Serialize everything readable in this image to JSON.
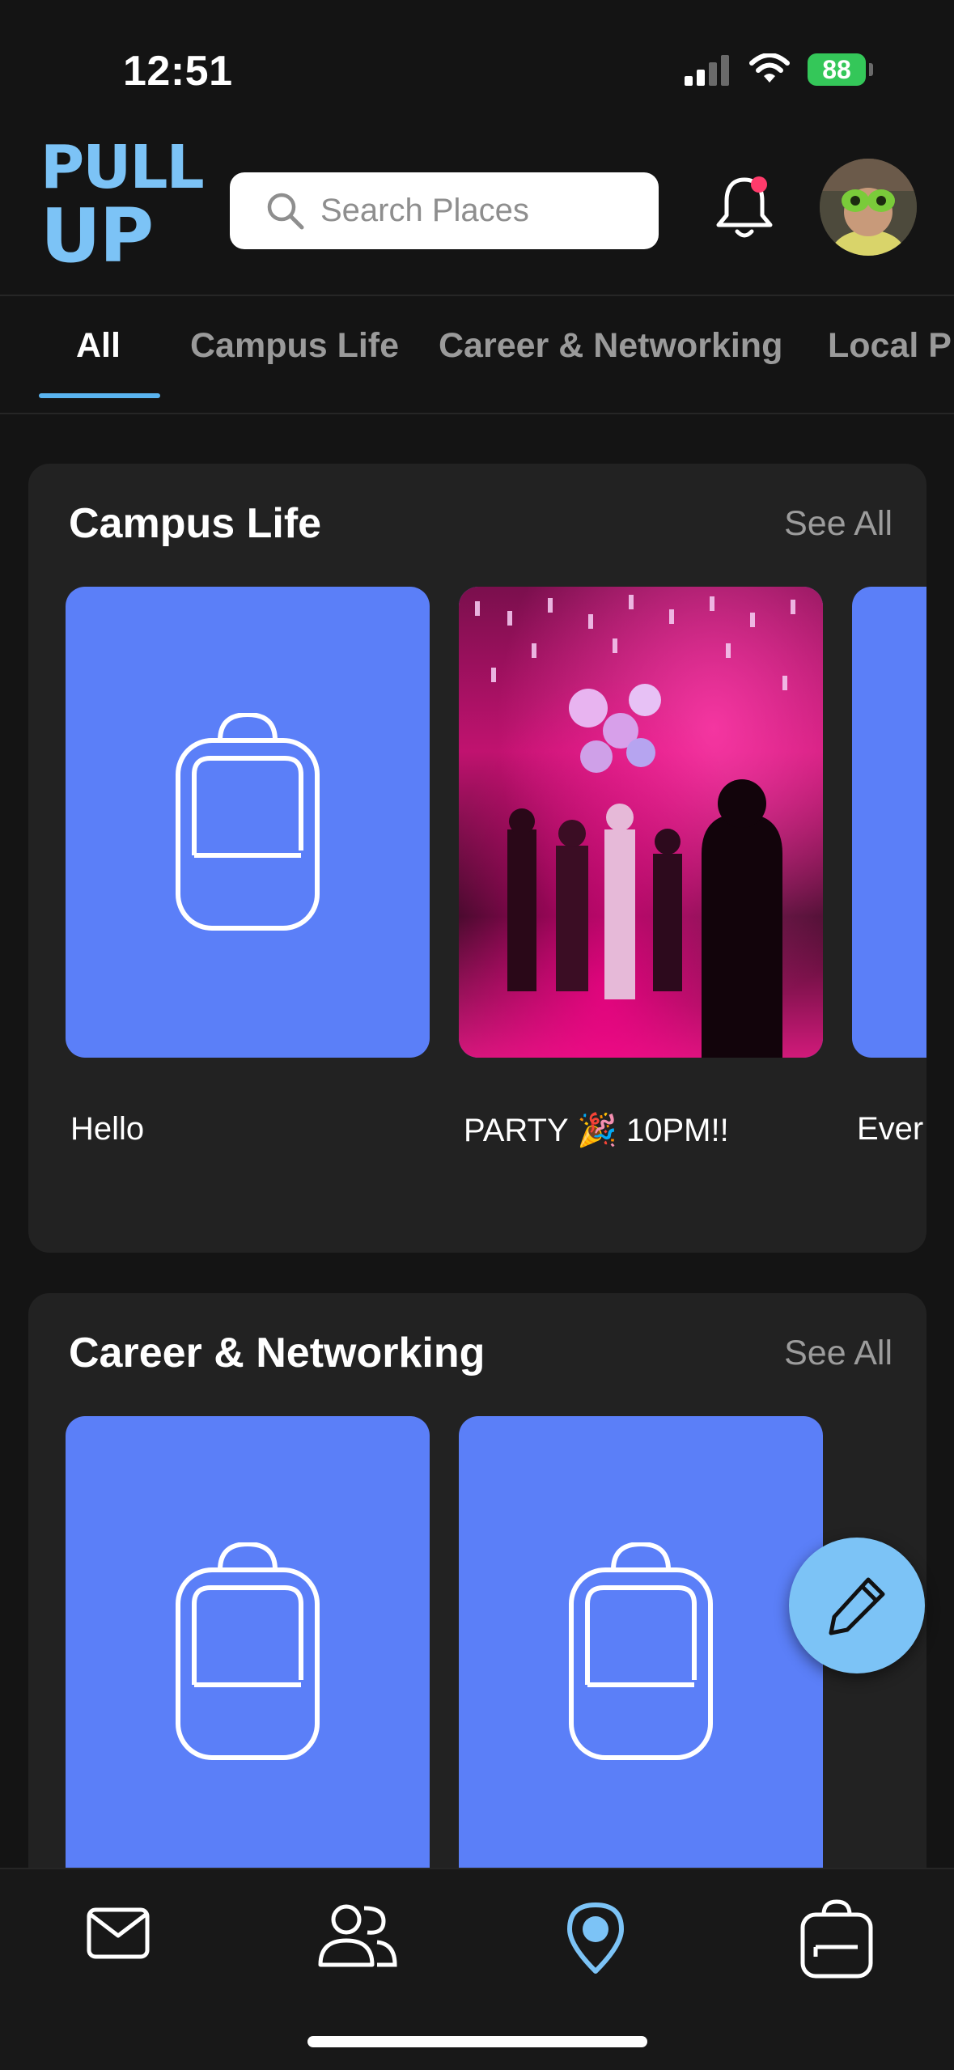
{
  "status_bar": {
    "time": "12:51",
    "battery": "88"
  },
  "header": {
    "logo_line1": "PULL",
    "logo_line2": "UP",
    "search_placeholder": "Search Places",
    "notification_badge_color": "#ff3b6b"
  },
  "tabs": [
    {
      "label": "All",
      "active": true
    },
    {
      "label": "Campus Life",
      "active": false
    },
    {
      "label": "Career & Networking",
      "active": false
    },
    {
      "label": "Local P",
      "active": false
    }
  ],
  "sections": [
    {
      "title": "Campus Life",
      "see_all": "See All",
      "cards": [
        {
          "caption": "Hello",
          "image": "backpack-icon"
        },
        {
          "caption": "PARTY 🎉 10PM!!",
          "image": "party-photo"
        },
        {
          "caption": "Ever",
          "image": "backpack-icon"
        }
      ]
    },
    {
      "title": "Career & Networking",
      "see_all": "See All",
      "cards": [
        {
          "caption": "",
          "image": "backpack-icon"
        },
        {
          "caption": "",
          "image": "backpack-icon"
        }
      ]
    }
  ],
  "fab": {
    "icon": "pencil-icon"
  },
  "bottom_nav": [
    {
      "icon": "mail-icon",
      "active": false
    },
    {
      "icon": "people-icon",
      "active": false
    },
    {
      "icon": "location-pin-icon",
      "active": true
    },
    {
      "icon": "backpack-icon",
      "active": false
    }
  ],
  "colors": {
    "accent": "#7cc3f6",
    "card_blue": "#5b7ff8",
    "background": "#141414",
    "section_background": "#222222",
    "battery_green": "#34c759"
  }
}
